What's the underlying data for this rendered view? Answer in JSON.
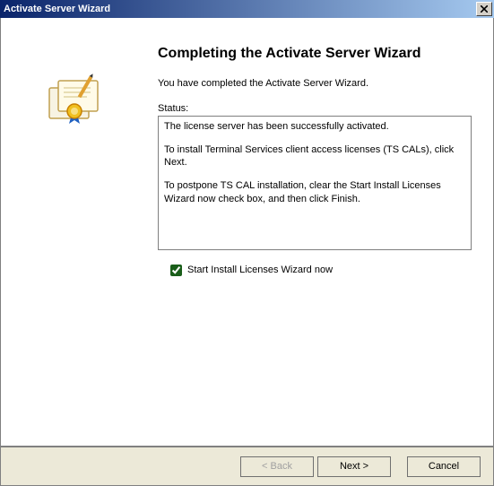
{
  "titlebar": {
    "title": "Activate Server Wizard",
    "close": "✕"
  },
  "heading": "Completing the Activate Server Wizard",
  "subtext": "You have completed the Activate Server Wizard.",
  "status_label": "Status:",
  "status": {
    "line1": "The license server has been successfully activated.",
    "line2": "To install Terminal Services client access licenses (TS CALs), click Next.",
    "line3": "To postpone TS CAL installation, clear the Start Install Licenses Wizard now check box, and then click Finish."
  },
  "checkbox": {
    "label": "Start Install Licenses Wizard now",
    "checked": true
  },
  "buttons": {
    "back": "< Back",
    "next": "Next >",
    "cancel": "Cancel"
  }
}
